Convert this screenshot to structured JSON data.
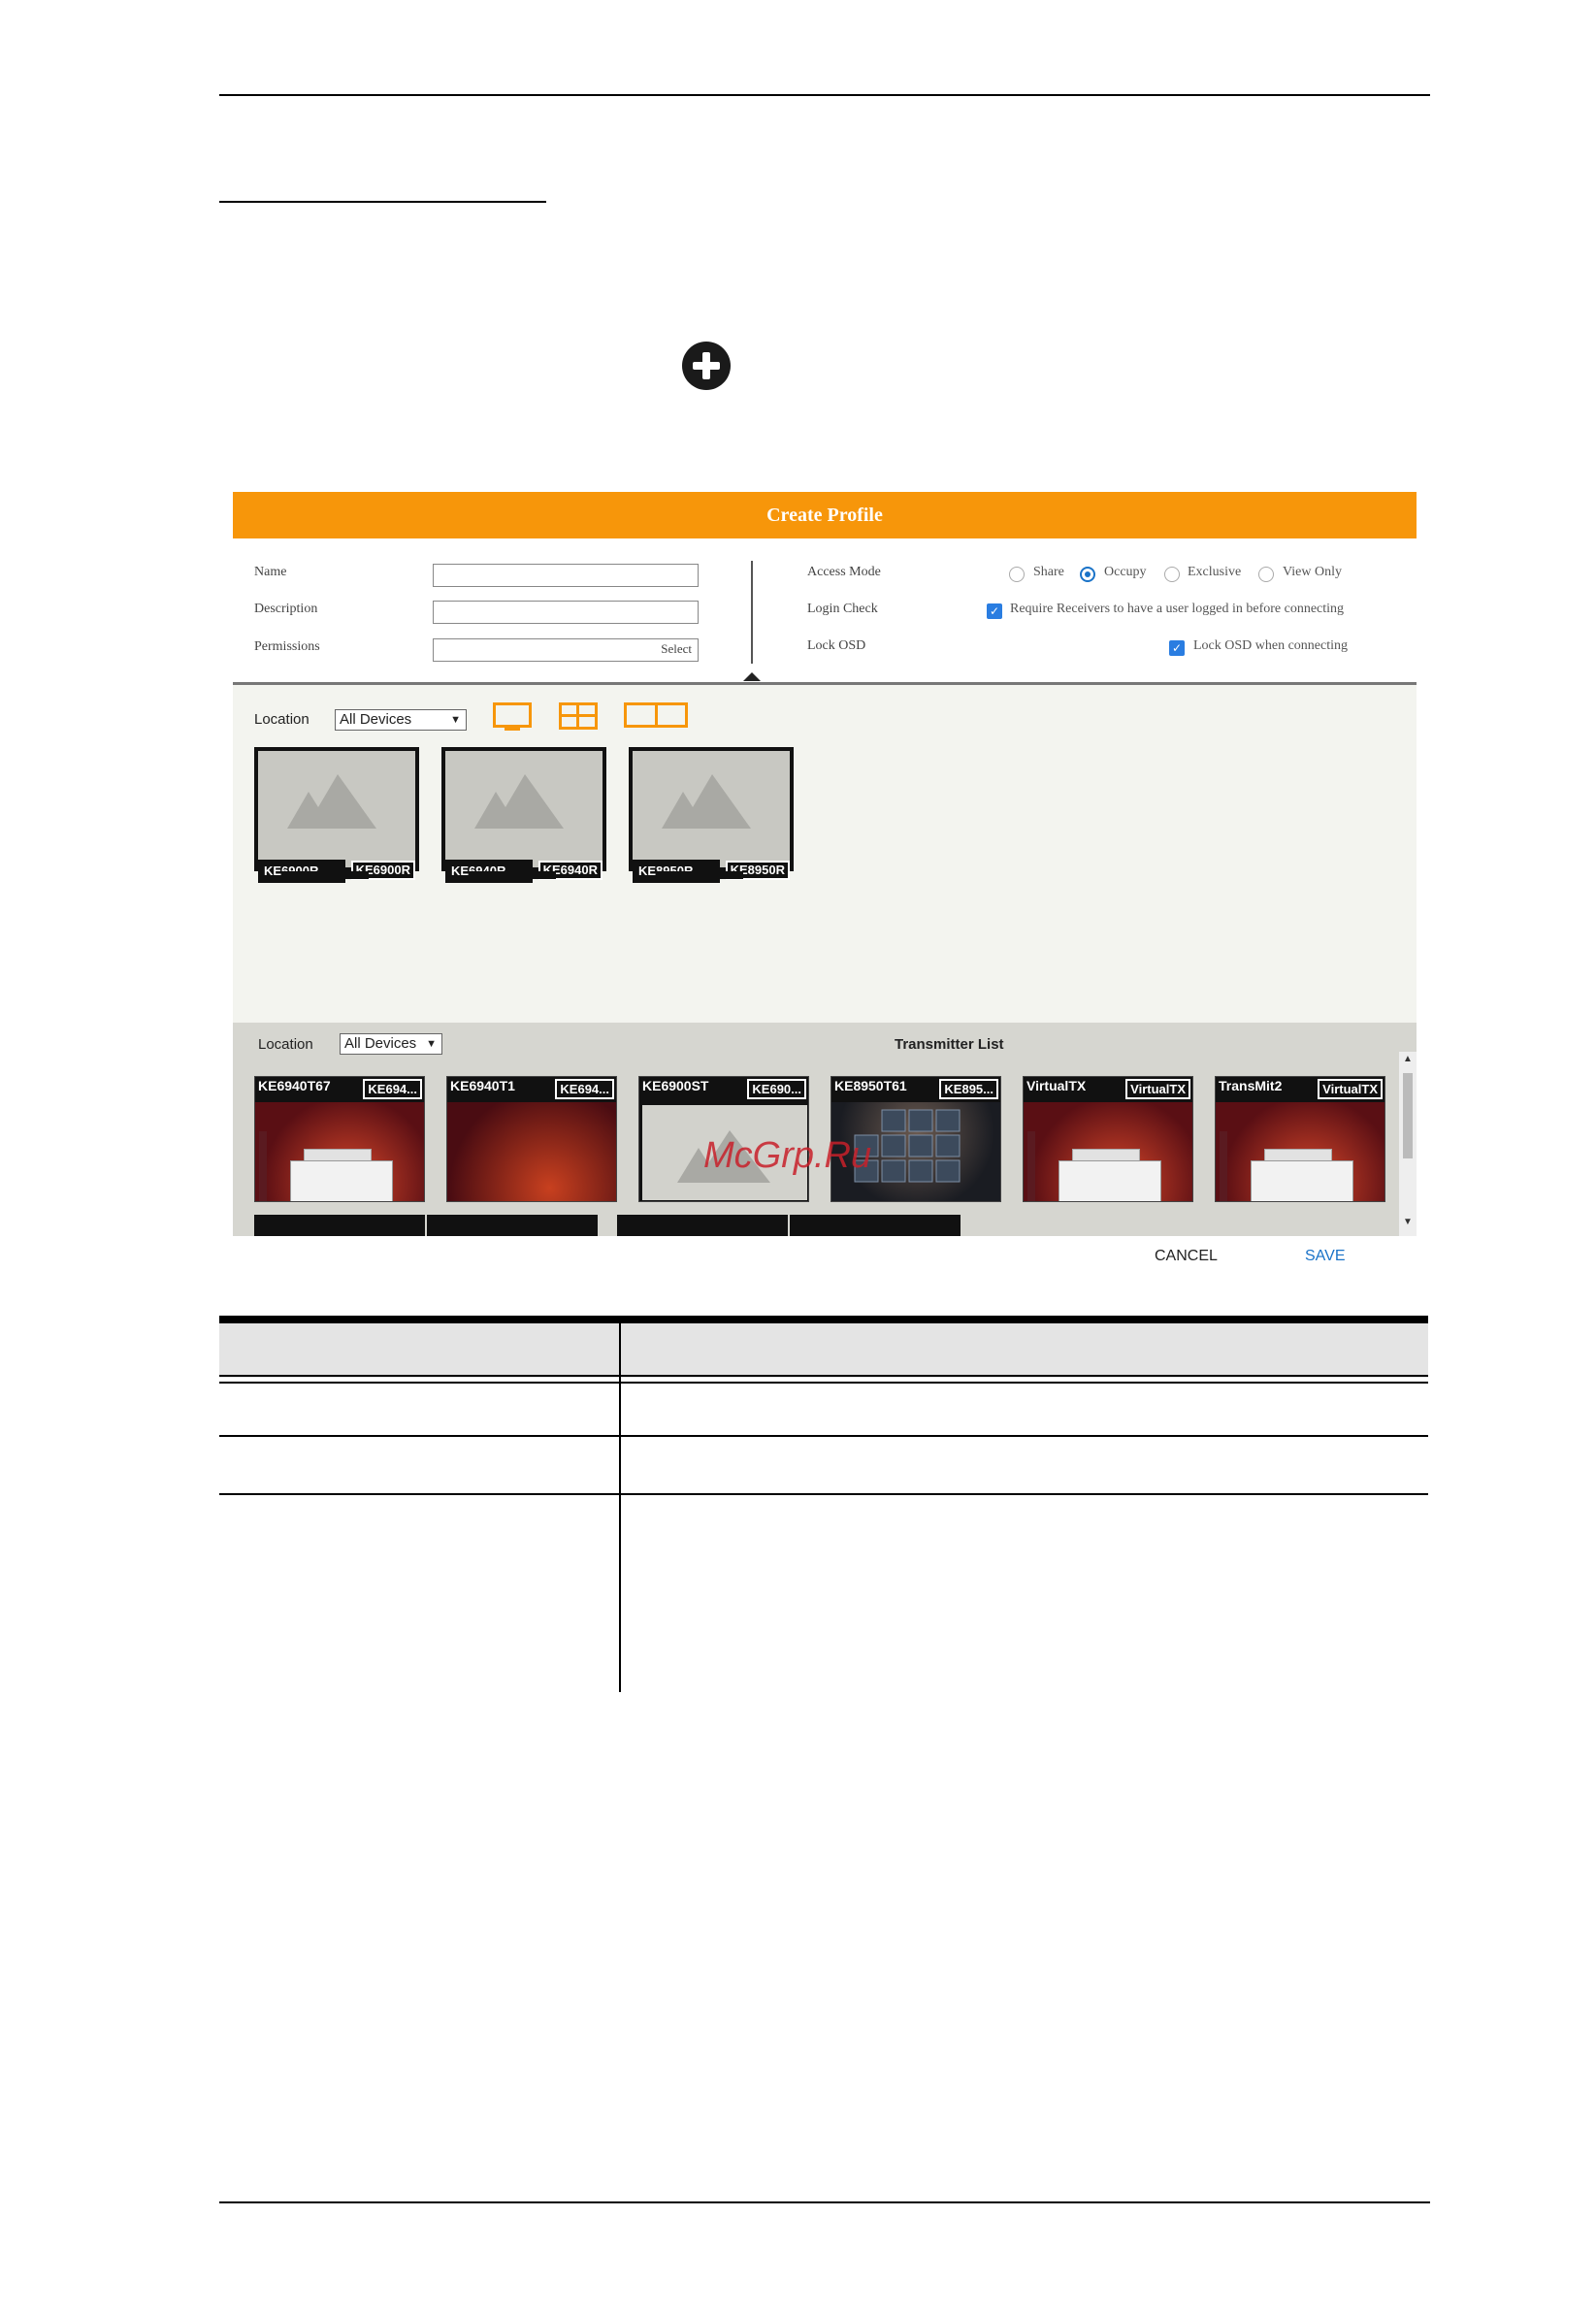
{
  "dialog": {
    "title": "Create Profile",
    "fields": {
      "name_label": "Name",
      "description_label": "Description",
      "permissions_label": "Permissions",
      "permissions_button": "Select",
      "name_value": "",
      "description_value": ""
    },
    "access_mode": {
      "label": "Access Mode",
      "options": [
        "Share",
        "Occupy",
        "Exclusive",
        "View Only"
      ],
      "selected": "Occupy"
    },
    "login_check": {
      "label": "Login Check",
      "checkbox_label": "Require Receivers to have a user logged in before connecting",
      "checked": true
    },
    "lock_osd": {
      "label": "Lock OSD",
      "checkbox_label": "Lock OSD when connecting",
      "checked": true
    },
    "receivers": {
      "location_label": "Location",
      "location_value": "All Devices",
      "items": [
        {
          "name": "KE6900R...",
          "tag": "KE6900R"
        },
        {
          "name": "KE6940R...",
          "tag": "KE6940R"
        },
        {
          "name": "KE8950R...",
          "tag": "KE8950R"
        }
      ]
    },
    "transmitters": {
      "location_label": "Location",
      "location_value": "All Devices",
      "title": "Transmitter List",
      "items": [
        {
          "name": "KE6940T67",
          "tag": "KE694..."
        },
        {
          "name": "KE6940T1",
          "tag": "KE694..."
        },
        {
          "name": "KE6900ST",
          "tag": "KE690..."
        },
        {
          "name": "KE8950T61",
          "tag": "KE895..."
        },
        {
          "name": "VirtualTX",
          "tag": "VirtualTX"
        },
        {
          "name": "TransMit2",
          "tag": "VirtualTX"
        }
      ]
    },
    "cancel_label": "CANCEL",
    "save_label": "SAVE"
  },
  "watermark": "McGrp.Ru",
  "colors": {
    "accent": "#f7960a",
    "save": "#1a73c8",
    "checkbox": "#2a7de1"
  }
}
